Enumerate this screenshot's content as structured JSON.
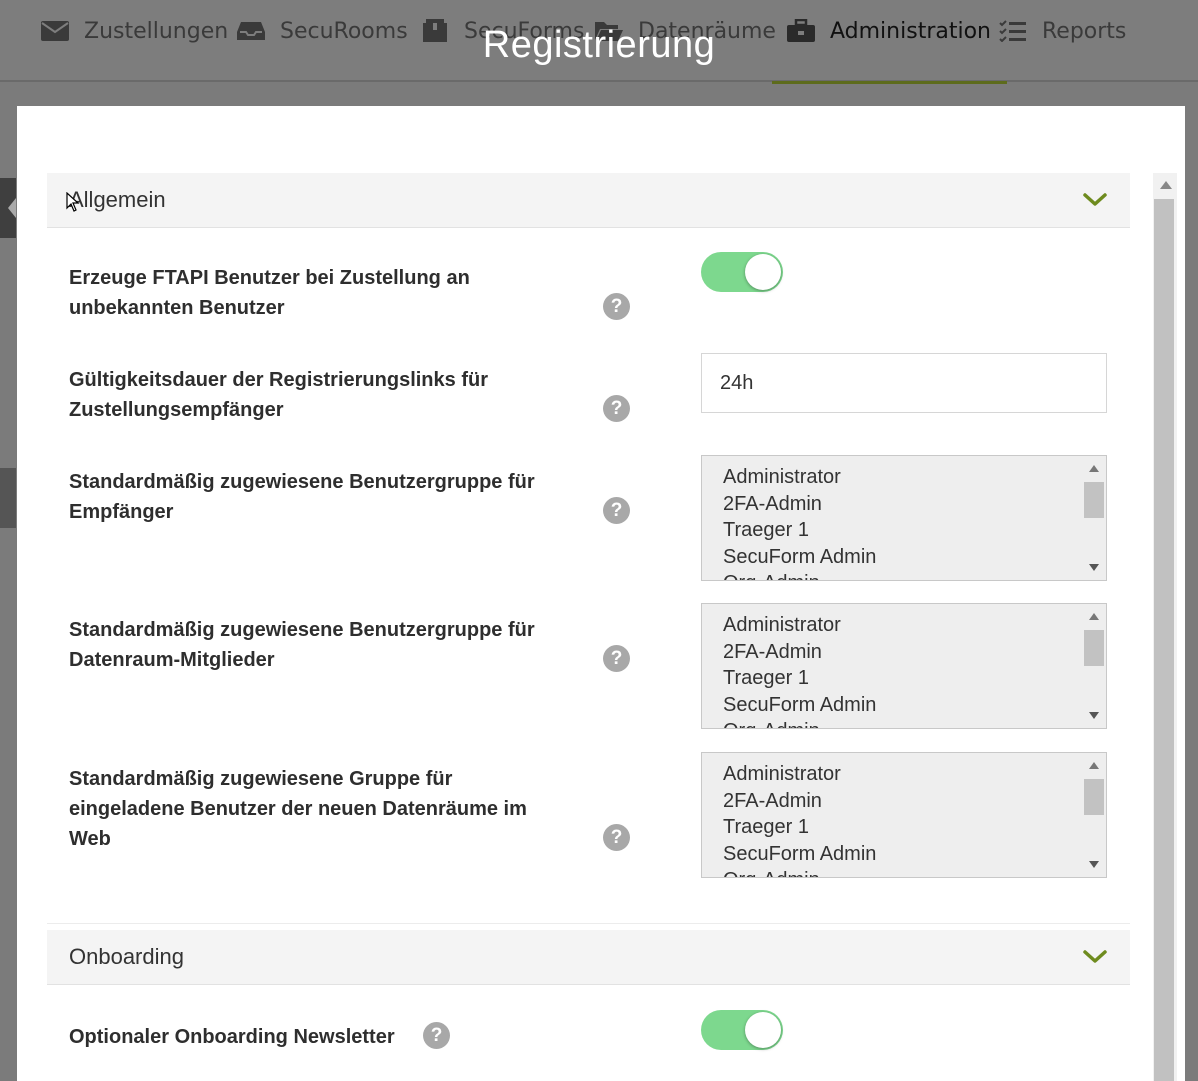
{
  "nav": {
    "items": [
      {
        "label": "Zustellungen",
        "icon": "envelope-icon"
      },
      {
        "label": "SecuRooms",
        "icon": "inbox-tray-icon"
      },
      {
        "label": "SecuForms",
        "icon": "box-icon"
      },
      {
        "label": "Datenräume",
        "icon": "folder-open-icon"
      },
      {
        "label": "Administration",
        "icon": "briefcase-icon",
        "active": true
      },
      {
        "label": "Reports",
        "icon": "checklist-icon"
      }
    ]
  },
  "modal": {
    "title": "Registrierung"
  },
  "sections": {
    "allgemein": {
      "title": "Allgemein",
      "settings": {
        "create_user": {
          "label": "Erzeuge FTAPI Benutzer bei Zustellung an unbekannten Benutzer",
          "enabled": true
        },
        "link_validity": {
          "label": "Gültigkeitsdauer der Registrierungslinks für Zustellungsempfänger",
          "value": "24h"
        },
        "recipient_group": {
          "label": "Standardmäßig zugewiesene Benutzergruppe für Empfänger",
          "options": [
            "Administrator",
            "2FA-Admin",
            "Traeger 1",
            "SecuForm Admin",
            "Org-Admin"
          ]
        },
        "dataroom_member_group": {
          "label": "Standardmäßig zugewiesene Benutzergruppe für Datenraum-Mitglieder",
          "options": [
            "Administrator",
            "2FA-Admin",
            "Traeger 1",
            "SecuForm Admin",
            "Org-Admin"
          ]
        },
        "invited_user_group": {
          "label": "Standardmäßig zugewiesene Gruppe für eingeladene Benutzer der neuen Datenräume im Web",
          "options": [
            "Administrator",
            "2FA-Admin",
            "Traeger 1",
            "SecuForm Admin",
            "Org-Admin"
          ]
        }
      }
    },
    "onboarding": {
      "title": "Onboarding",
      "settings": {
        "newsletter": {
          "label": "Optionaler Onboarding Newsletter",
          "enabled": true
        }
      }
    }
  },
  "help_glyph": "?",
  "colors": {
    "accent": "#6e8b1e",
    "toggle_on": "#7dd88e",
    "nav_active_underline": "#5d6b1c"
  }
}
